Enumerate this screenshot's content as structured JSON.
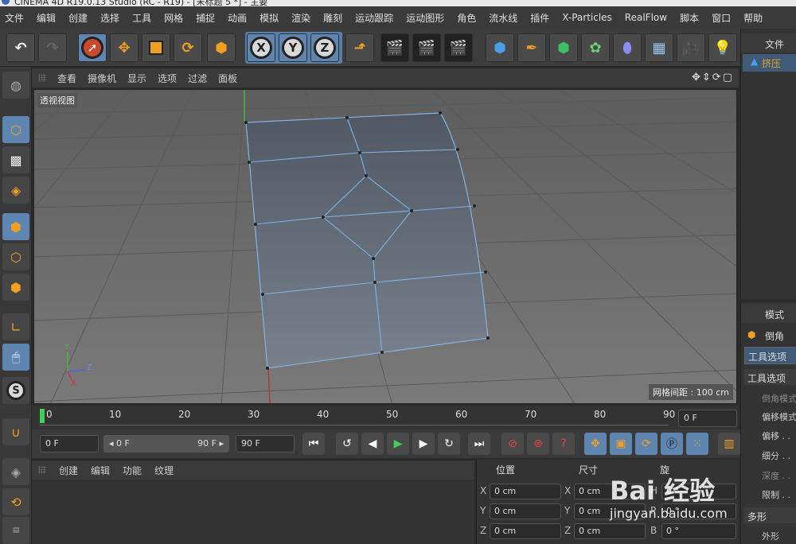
{
  "window": {
    "title": "CINEMA 4D R19.0.13 Studio (RC - R19) - [未标题 5 *] - 主要"
  },
  "menu": [
    "文件",
    "编辑",
    "创建",
    "选择",
    "工具",
    "网格",
    "捕捉",
    "动画",
    "模拟",
    "渲染",
    "雕刻",
    "运动跟踪",
    "运动图形",
    "角色",
    "流水线",
    "插件",
    "X-Particles",
    "RealFlow",
    "脚本",
    "窗口",
    "帮助"
  ],
  "toolbar": {
    "x_label": "X",
    "y_label": "Y",
    "z_label": "Z"
  },
  "viewport": {
    "menu": [
      "查看",
      "摄像机",
      "显示",
      "选项",
      "过滤",
      "面板"
    ],
    "view_name": "透视视图",
    "grid_spacing": "网格间距 : 100 cm",
    "gizmo": {
      "y": "Y",
      "z": "Z",
      "x": "X"
    }
  },
  "timeline": {
    "ticks": [
      "0",
      "10",
      "20",
      "30",
      "40",
      "50",
      "60",
      "70",
      "80",
      "90"
    ],
    "current_frame": "0 F"
  },
  "transport": {
    "start_frame": "0 F",
    "range_start": "◂ 0 F",
    "range_end": "90 F ▸",
    "end_frame": "90 F"
  },
  "bottom_panel": {
    "menu": [
      "创建",
      "编辑",
      "功能",
      "纹理"
    ]
  },
  "coords": {
    "header_pos": "位置",
    "header_size": "尺寸",
    "header_rot": "旋",
    "rows": [
      {
        "axis": "X",
        "pos": "0 cm",
        "size_axis": "X",
        "size": "0 cm",
        "rot_axis": "H",
        "rot": "0 °"
      },
      {
        "axis": "Y",
        "pos": "0 cm",
        "size_axis": "Y",
        "size": "0 cm",
        "rot_axis": "P",
        "rot": "0 °"
      },
      {
        "axis": "Z",
        "pos": "0 cm",
        "size_axis": "Z",
        "size": "0 cm",
        "rot_axis": "B",
        "rot": "0 °"
      }
    ]
  },
  "object_panel": {
    "tab": "文件",
    "object": "挤压"
  },
  "attribute_panel": {
    "tab": "模式",
    "tool_name": "倒角",
    "tab_tool_options": "工具选项",
    "section": "工具选项",
    "fields": [
      "倒角模式",
      "偏移模式",
      "偏移 . .",
      "细分 . .",
      "深度 . .",
      "限制 . ."
    ],
    "section2": "多形",
    "field_shape": "外形"
  },
  "watermark": {
    "brand": "Bai 经验",
    "url": "jingyan.baidu.com"
  },
  "colors": {
    "accent": "#5f86b0",
    "viewport_bg": "#6c6c6c",
    "mesh": "#5e6a78",
    "edge": "#7fb3e6"
  }
}
